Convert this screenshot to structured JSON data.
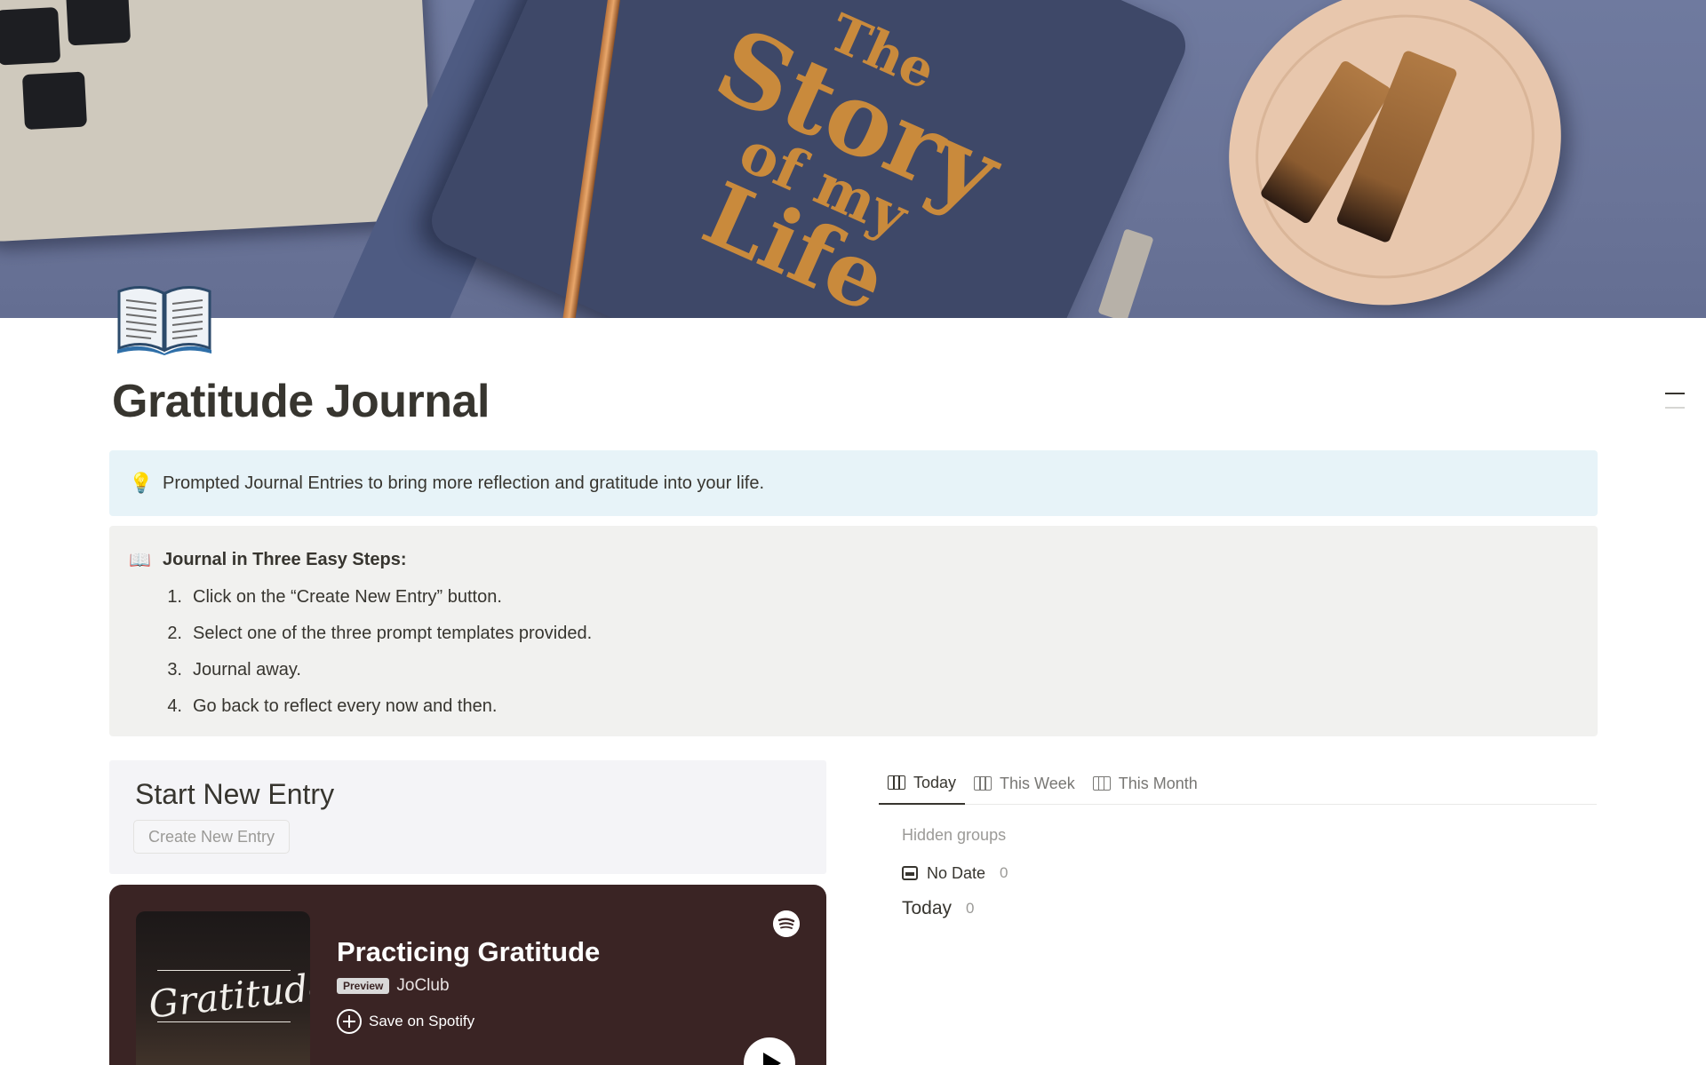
{
  "page": {
    "title": "Gratitude Journal",
    "icon": "open-book-icon"
  },
  "cover": {
    "book_title_lines": [
      "The",
      "Story",
      "of my",
      "Life"
    ]
  },
  "callout_tip": {
    "icon": "lightbulb-icon",
    "text": "Prompted Journal Entries to bring more reflection and gratitude into your life."
  },
  "callout_steps": {
    "icon": "open-book-icon",
    "heading": "Journal in Three Easy Steps:",
    "steps": [
      {
        "num": "1.",
        "text": "Click on the “Create New Entry” button."
      },
      {
        "num": "2.",
        "text": "Select one of the three prompt templates provided."
      },
      {
        "num": "3.",
        "text": "Journal away."
      },
      {
        "num": "4.",
        "text": "Go back to reflect every now and then."
      }
    ]
  },
  "entry": {
    "heading": "Start New Entry",
    "button_label": "Create New Entry"
  },
  "spotify": {
    "cover_text": "Gratitude",
    "title": "Practicing Gratitude",
    "badge": "Preview",
    "artist": "JoClub",
    "save_label": "Save on Spotify",
    "bg_color": "#3a2424"
  },
  "views": {
    "tabs": [
      {
        "label": "Today",
        "active": true,
        "icon": "board-view-icon"
      },
      {
        "label": "This Week",
        "active": false,
        "icon": "board-view-icon"
      },
      {
        "label": "This Month",
        "active": false,
        "icon": "board-view-icon"
      }
    ],
    "hidden_groups_label": "Hidden groups",
    "groups": [
      {
        "label": "No Date",
        "count": "0",
        "icon": "inbox-icon"
      },
      {
        "label": "Today",
        "count": "0"
      }
    ]
  },
  "colors": {
    "tip_callout_bg": "#e7f3f8",
    "steps_callout_bg": "#f1f1ef",
    "text": "#37352f",
    "muted": "#9b9a97"
  }
}
